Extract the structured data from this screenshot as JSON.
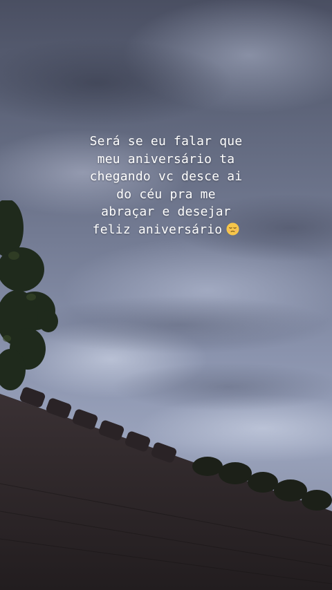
{
  "story": {
    "caption_line1": "Será se eu falar que",
    "caption_line2": "meu aniversário ta",
    "caption_line3": "chegando vc desce ai",
    "caption_line4": "do céu pra me",
    "caption_line5": "abraçar e desejar",
    "caption_line6": "feliz aniversário",
    "emoji": "pensive-face-emoji"
  },
  "colors": {
    "sky_top": "#4a4f62",
    "sky_bottom": "#9aa3bc",
    "wall": "#2b2628",
    "foliage": "#1f2a1c",
    "emoji": "#f7c64a"
  }
}
